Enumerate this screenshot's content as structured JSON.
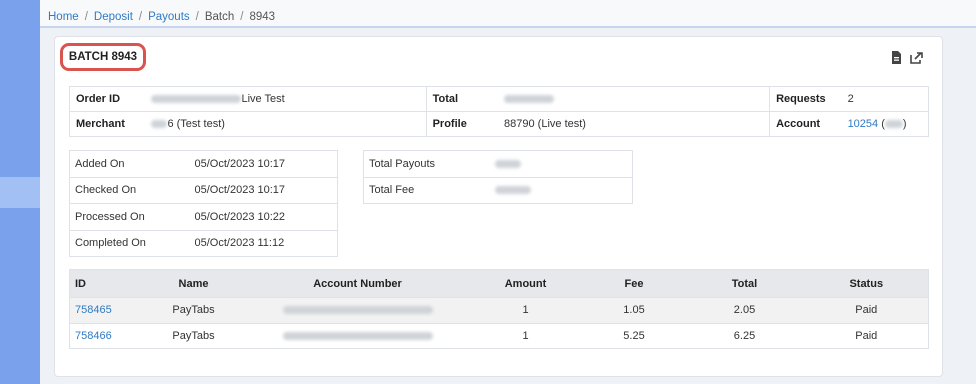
{
  "breadcrumb": [
    "Home",
    "Deposit",
    "Payouts",
    "Batch",
    "8943"
  ],
  "card": {
    "title": "BATCH 8943"
  },
  "info": {
    "order_id_label": "Order ID",
    "order_id_suffix": "Live Test",
    "total_label": "Total",
    "requests_label": "Requests",
    "requests_value": "2",
    "merchant_label": "Merchant",
    "merchant_suffix": "6 (Test test)",
    "profile_label": "Profile",
    "profile_value": "88790 (Live test)",
    "account_label": "Account",
    "account_link": "10254",
    "account_open": " (",
    "account_close": ")"
  },
  "dates": [
    {
      "label": "Added On",
      "value": "05/Oct/2023 10:17"
    },
    {
      "label": "Checked On",
      "value": "05/Oct/2023 10:17"
    },
    {
      "label": "Processed On",
      "value": "05/Oct/2023 10:22"
    },
    {
      "label": "Completed On",
      "value": "05/Oct/2023 11:12"
    }
  ],
  "totals": {
    "total_payouts_label": "Total Payouts",
    "total_fee_label": "Total Fee"
  },
  "transactions": {
    "headers": [
      "ID",
      "Name",
      "Account Number",
      "Amount",
      "Fee",
      "Total",
      "Status"
    ],
    "rows": [
      {
        "id": "758465",
        "name": "PayTabs",
        "amount": "1",
        "fee": "1.05",
        "total": "2.05",
        "status": "Paid"
      },
      {
        "id": "758466",
        "name": "PayTabs",
        "amount": "1",
        "fee": "5.25",
        "total": "6.25",
        "status": "Paid"
      }
    ]
  },
  "icons": [
    "pdf-export-icon",
    "share-icon"
  ],
  "colors": {
    "link": "#2f7bc2",
    "highlight": "#d9534f",
    "sidebar": "#7aa2ec"
  }
}
